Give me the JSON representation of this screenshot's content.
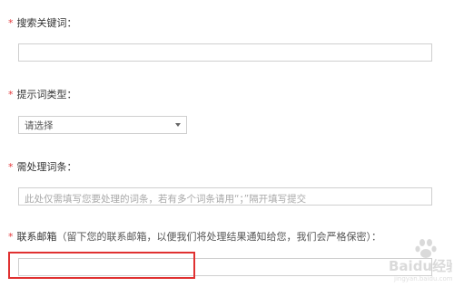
{
  "form": {
    "required_mark": "*",
    "keyword": {
      "label": "搜索关键词：",
      "value": "",
      "placeholder": ""
    },
    "prompt_type": {
      "label": "提示词类型：",
      "selected": "请选择"
    },
    "terms": {
      "label": "需处理词条：",
      "value": "",
      "placeholder": "此处仅需填写您要处理的词条，若有多个词条请用“；”隔开填写提交"
    },
    "email": {
      "label": "联系邮箱",
      "note": "（留下您的联系邮箱，以便我们将处理结果通知给您，我们会严格保密）：",
      "value": "",
      "placeholder": ""
    }
  },
  "watermark": {
    "logo_text": "Baidu经验",
    "sub_text": "jingyan.baidu.com"
  },
  "colors": {
    "required": "#e4393c",
    "highlight": "#e03131",
    "border": "#cfcfcf"
  }
}
